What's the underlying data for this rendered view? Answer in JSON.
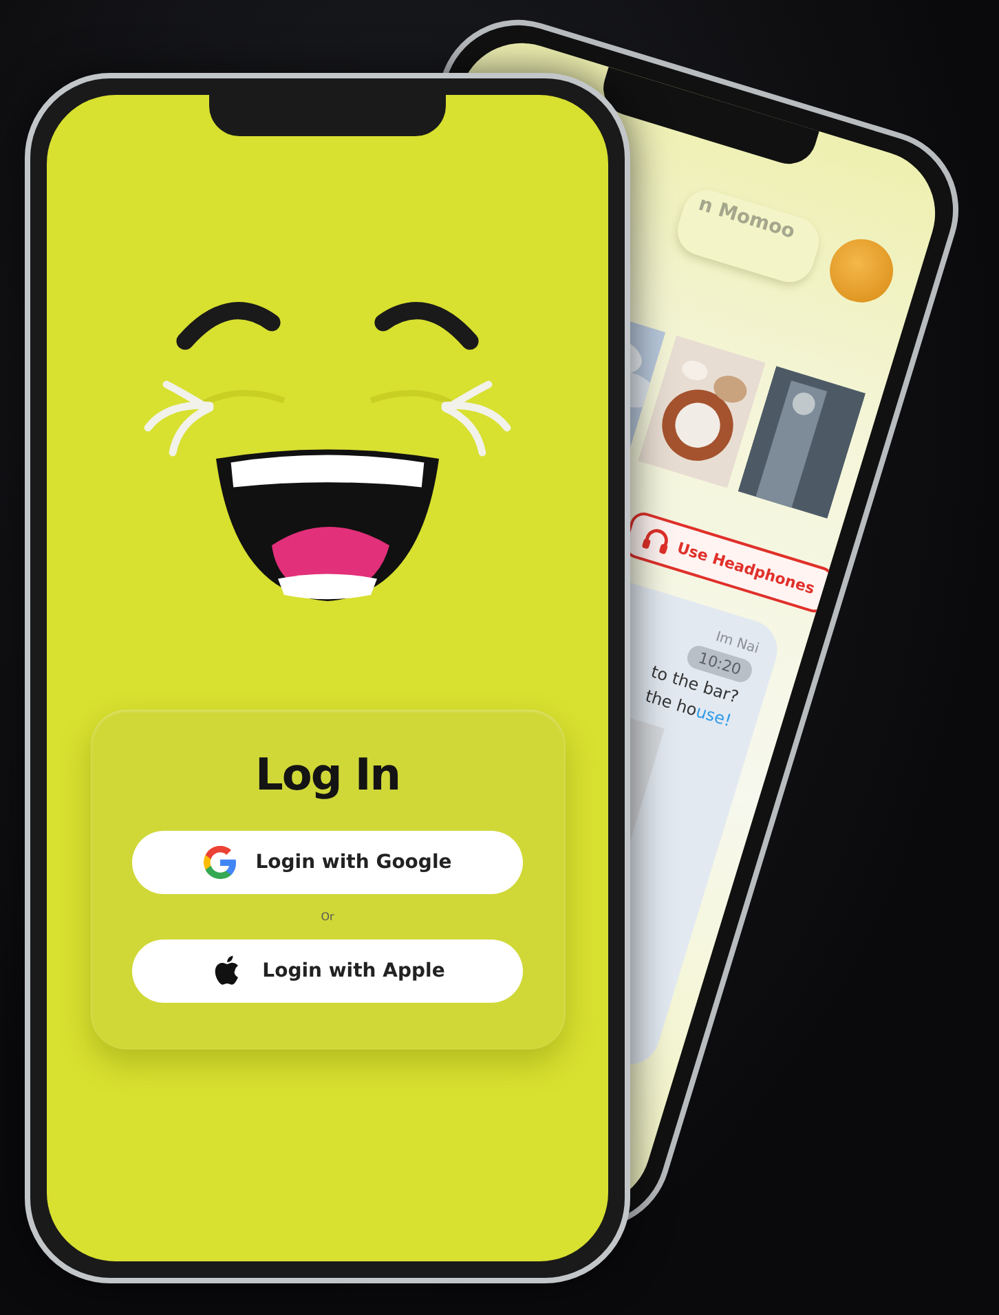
{
  "back_phone": {
    "search": {
      "value": "n Momoo"
    },
    "notice": "Use Headphones",
    "post": {
      "author": "Im Nai",
      "time": "10:20",
      "lines": [
        {
          "text": "to the bar?"
        },
        {
          "text": "the ho",
          "highlight": "use!"
        }
      ]
    }
  },
  "front_phone": {
    "login_card": {
      "title": "Log In",
      "separator": "Or",
      "buttons": [
        {
          "kind": "google",
          "label": "Login with Google"
        },
        {
          "kind": "apple",
          "label": "Login with Apple"
        }
      ]
    }
  }
}
